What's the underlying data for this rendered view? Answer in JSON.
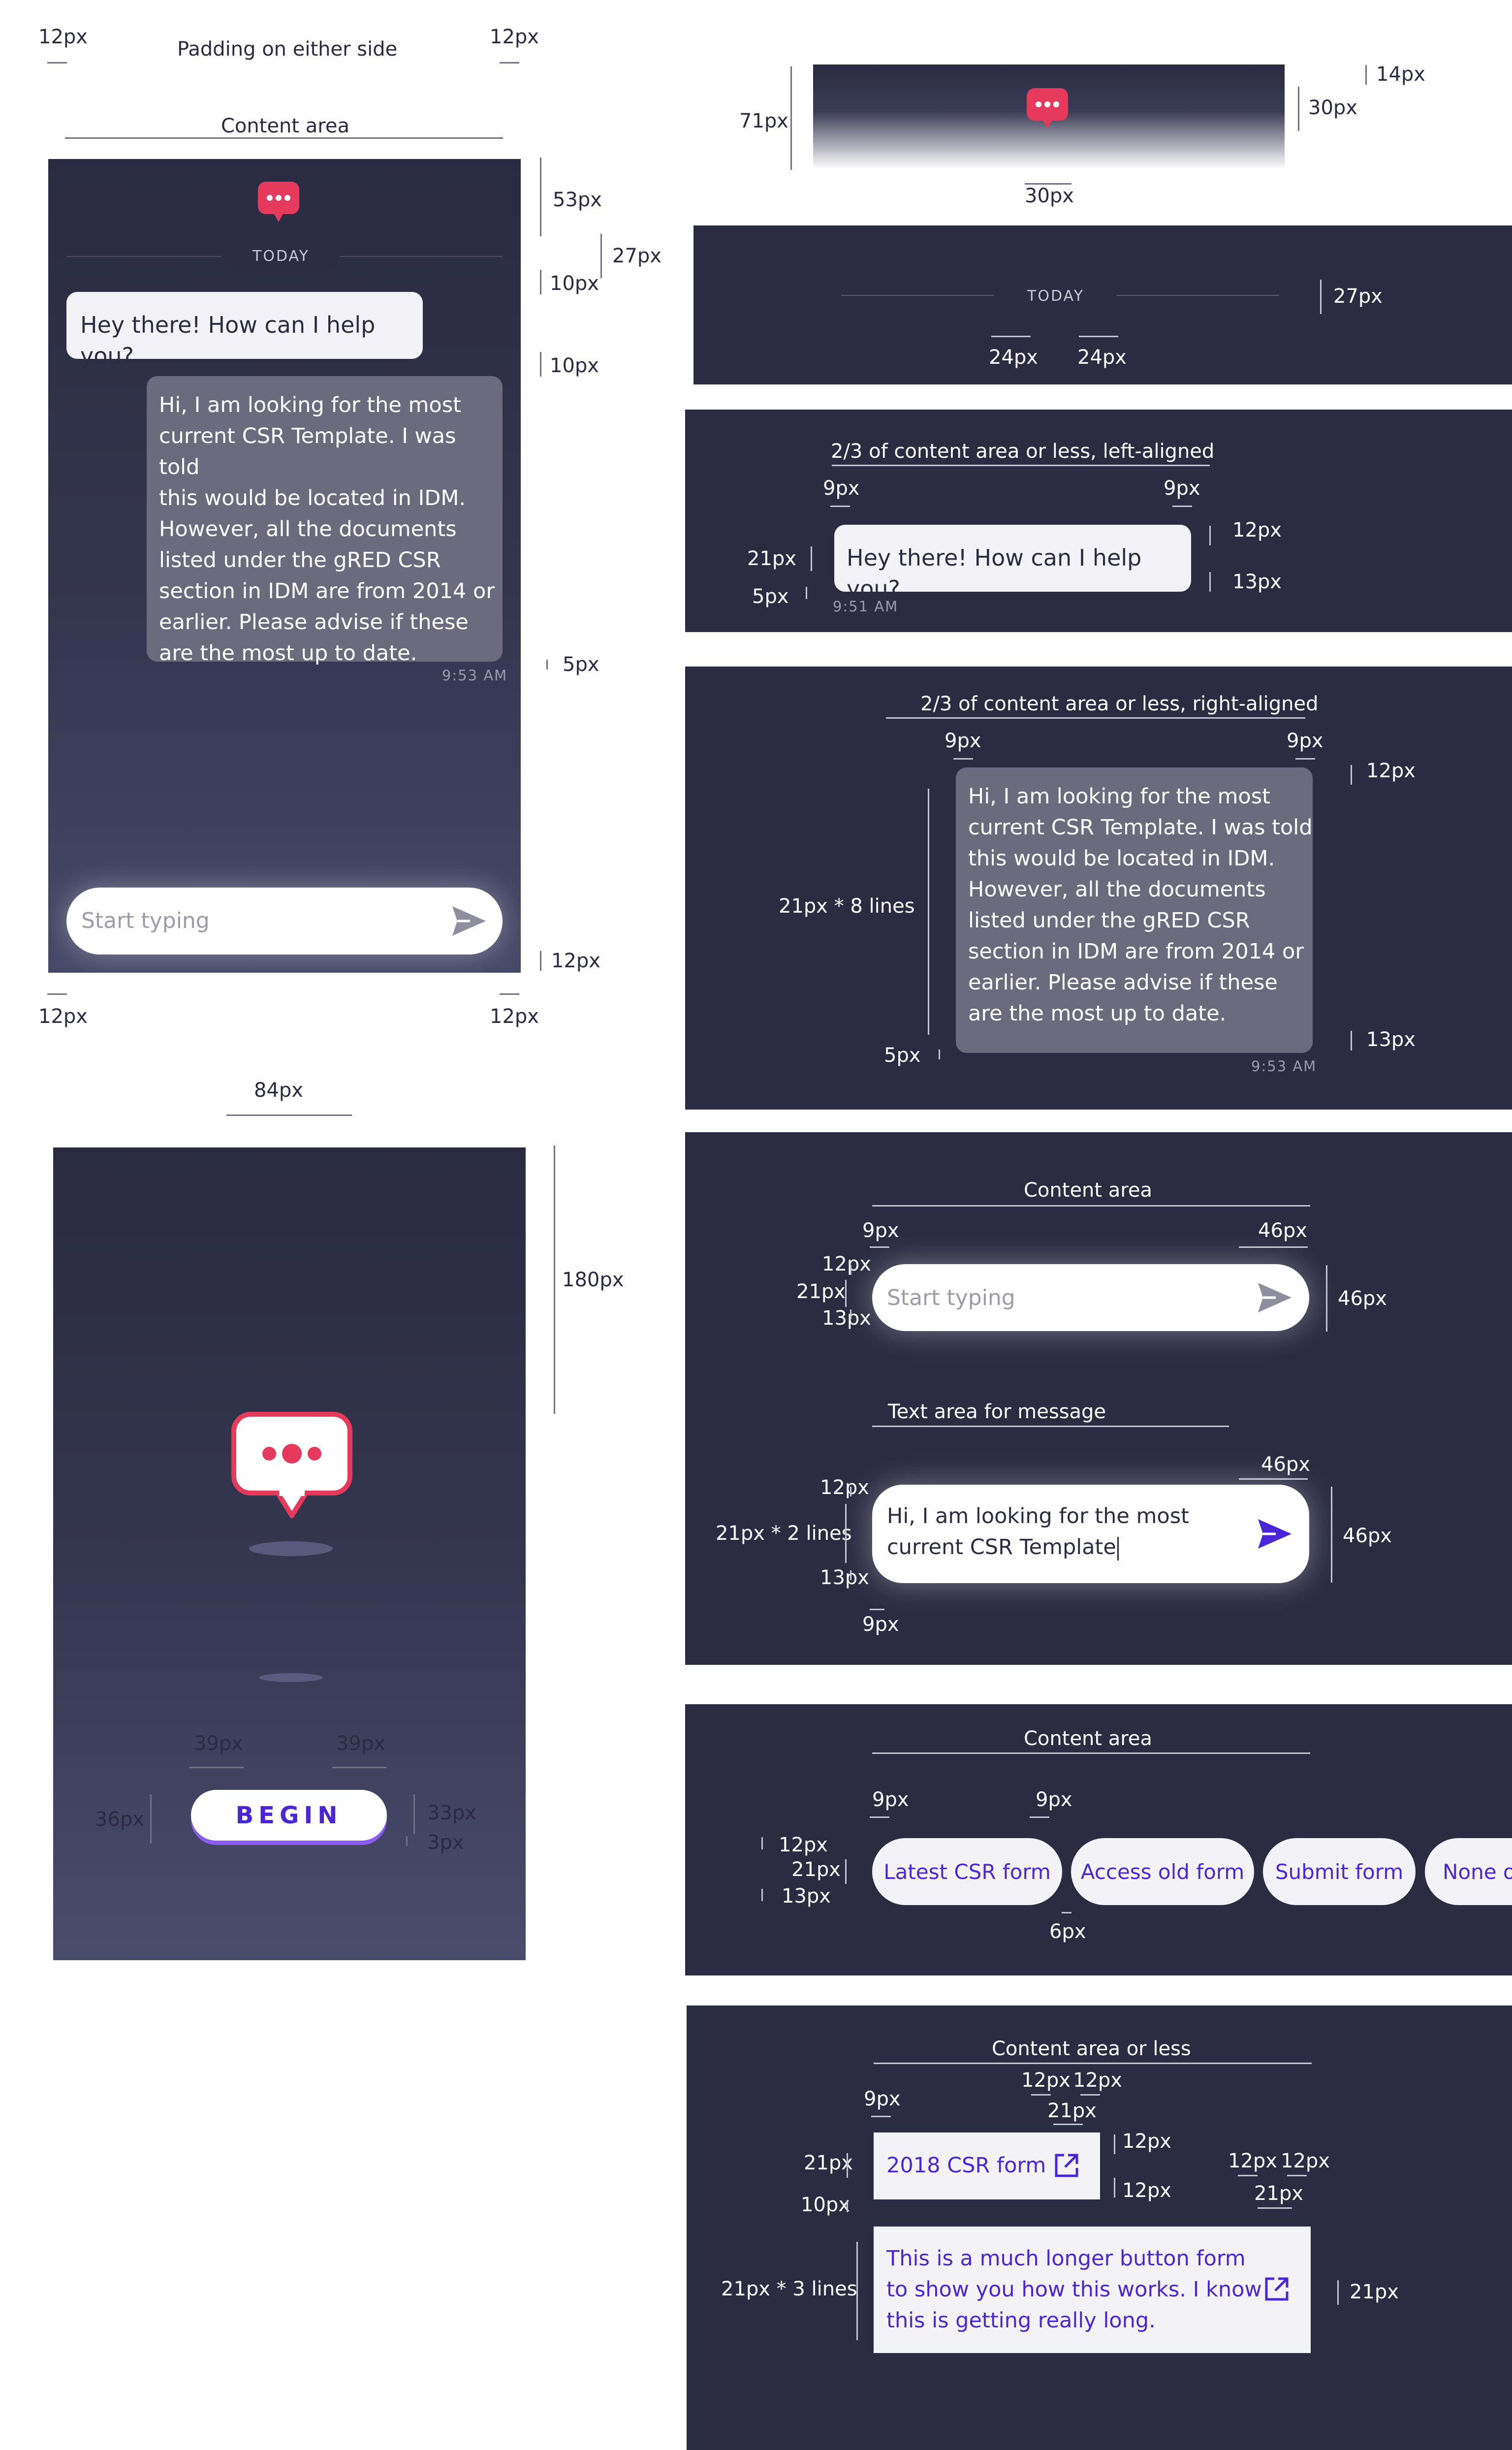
{
  "colors": {
    "panel": "#2b2c42",
    "accent": "#4a26d6",
    "brand": "#e53a5b",
    "bubble_in": "#f3f2f7",
    "bubble_out": "#6c6b7d"
  },
  "icons": {
    "chat_logo": "chat-bubble-dots-icon",
    "send": "paper-plane-send-icon",
    "external": "external-link-icon"
  },
  "chat": {
    "today": "TODAY",
    "greeting": "Hey there! How can I help you?",
    "user_lines": [
      "Hi, I am looking for the most",
      "current CSR Template. I was told",
      "this would be located in IDM.",
      "However, all the documents",
      "listed under the gRED CSR",
      "section in IDM are from 2014 or",
      "earlier. Please advise if these",
      "are the most up to date."
    ],
    "time_in": "9:51 AM",
    "time_out": "9:53 AM",
    "placeholder": "Start typing",
    "typed_line1": "Hi, I am looking for the most",
    "typed_line2": "current CSR Template"
  },
  "welcome": {
    "begin_label": "BEGIN"
  },
  "chips": [
    "Latest CSR form",
    "Access old form",
    "Submit form",
    "None o"
  ],
  "link_buttons": {
    "short": "2018 CSR form",
    "long_lines": [
      "This is a much longer button form",
      "to show you how this works. I know",
      "this is getting really long."
    ]
  },
  "annotations": {
    "padding_note": "Padding on either side",
    "content_area": "Content area",
    "content_area_or_less": "Content area or less",
    "left_aligned": "2/3 of content area or less, left-aligned",
    "right_aligned": "2/3 of content area or less, right-aligned",
    "text_area": "Text area for message",
    "v_3px": "3px",
    "v_5px": "5px",
    "v_6px": "6px",
    "v_9px": "9px",
    "v_10px": "10px",
    "v_12px": "12px",
    "v_13px": "13px",
    "v_14px": "14px",
    "v_21px": "21px",
    "v_24px": "24px",
    "v_27px": "27px",
    "v_30px": "30px",
    "v_33px": "33px",
    "v_36px": "36px",
    "v_39px": "39px",
    "v_46px": "46px",
    "v_53px": "53px",
    "v_71px": "71px",
    "v_84px": "84px",
    "v_180px": "180px",
    "lines8": "21px * 8 lines",
    "lines2": "21px * 2 lines",
    "lines3": "21px * 3 lines"
  }
}
